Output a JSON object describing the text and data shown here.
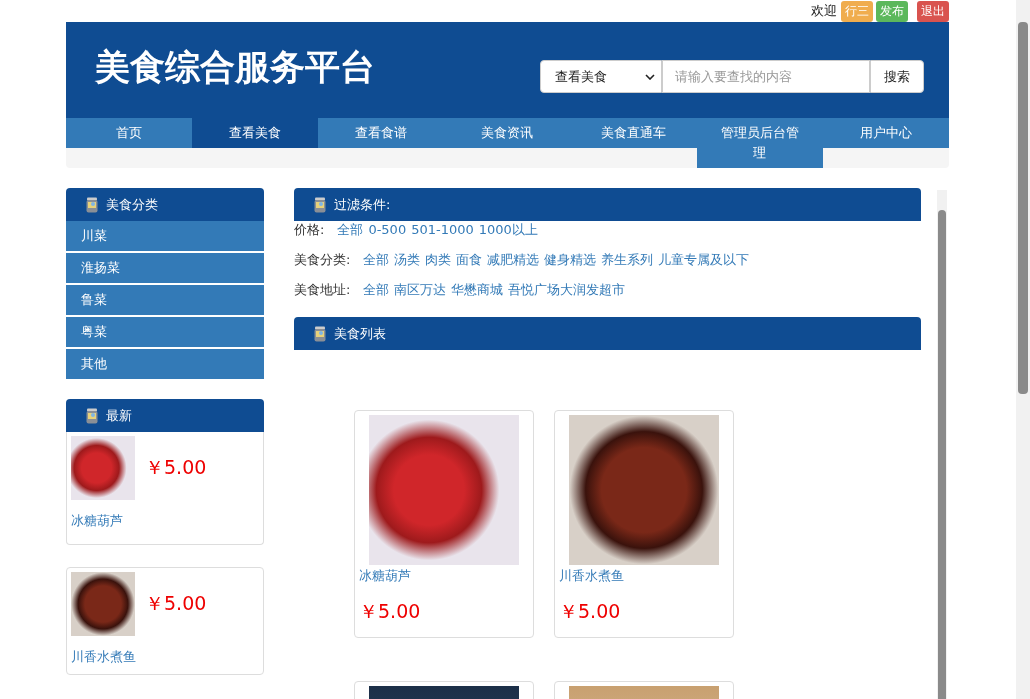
{
  "top_bar": {
    "welcome": "欢迎",
    "user": "行三",
    "publish": "发布",
    "logout": "退出"
  },
  "header": {
    "title": "美食综合服务平台",
    "search": {
      "select": "查看美食",
      "placeholder": "请输入要查找的内容",
      "button": "搜索"
    }
  },
  "nav": [
    {
      "label": "首页",
      "selected": false
    },
    {
      "label": "查看美食",
      "selected": true
    },
    {
      "label": "查看食谱",
      "selected": false
    },
    {
      "label": "美食资讯",
      "selected": false
    },
    {
      "label": "美食直通车",
      "selected": false
    },
    {
      "label": "管理员后台管理",
      "selected": false
    },
    {
      "label": "用户中心",
      "selected": false
    }
  ],
  "sidebar": {
    "categories_title": "美食分类",
    "categories": [
      "川菜",
      "淮扬菜",
      "鲁菜",
      "粤菜",
      "其他"
    ],
    "latest_title": "最新",
    "latest": [
      {
        "name": "冰糖葫芦",
        "price": "￥5.00"
      },
      {
        "name": "川香水煮鱼",
        "price": "￥5.00"
      }
    ]
  },
  "filters": {
    "title": "过滤条件:",
    "rows": [
      {
        "label": "价格:",
        "options": [
          "全部",
          "0-500",
          "501-1000",
          "1000以上"
        ]
      },
      {
        "label": "美食分类:",
        "options": [
          "全部",
          "汤类",
          "肉类",
          "面食",
          "减肥精选",
          "健身精选",
          "养生系列",
          "儿童专属及以下"
        ]
      },
      {
        "label": "美食地址:",
        "options": [
          "全部",
          "南区万达",
          "华懋商城",
          "吾悦广场大润发超市"
        ]
      }
    ]
  },
  "list": {
    "title": "美食列表",
    "products": [
      {
        "kind": "full",
        "name": "冰糖葫芦",
        "price": "￥5.00"
      },
      {
        "kind": "full",
        "name": "川香水煮鱼",
        "price": "￥5.00"
      },
      {
        "kind": "photo-only"
      },
      {
        "kind": "photo-only"
      }
    ]
  }
}
